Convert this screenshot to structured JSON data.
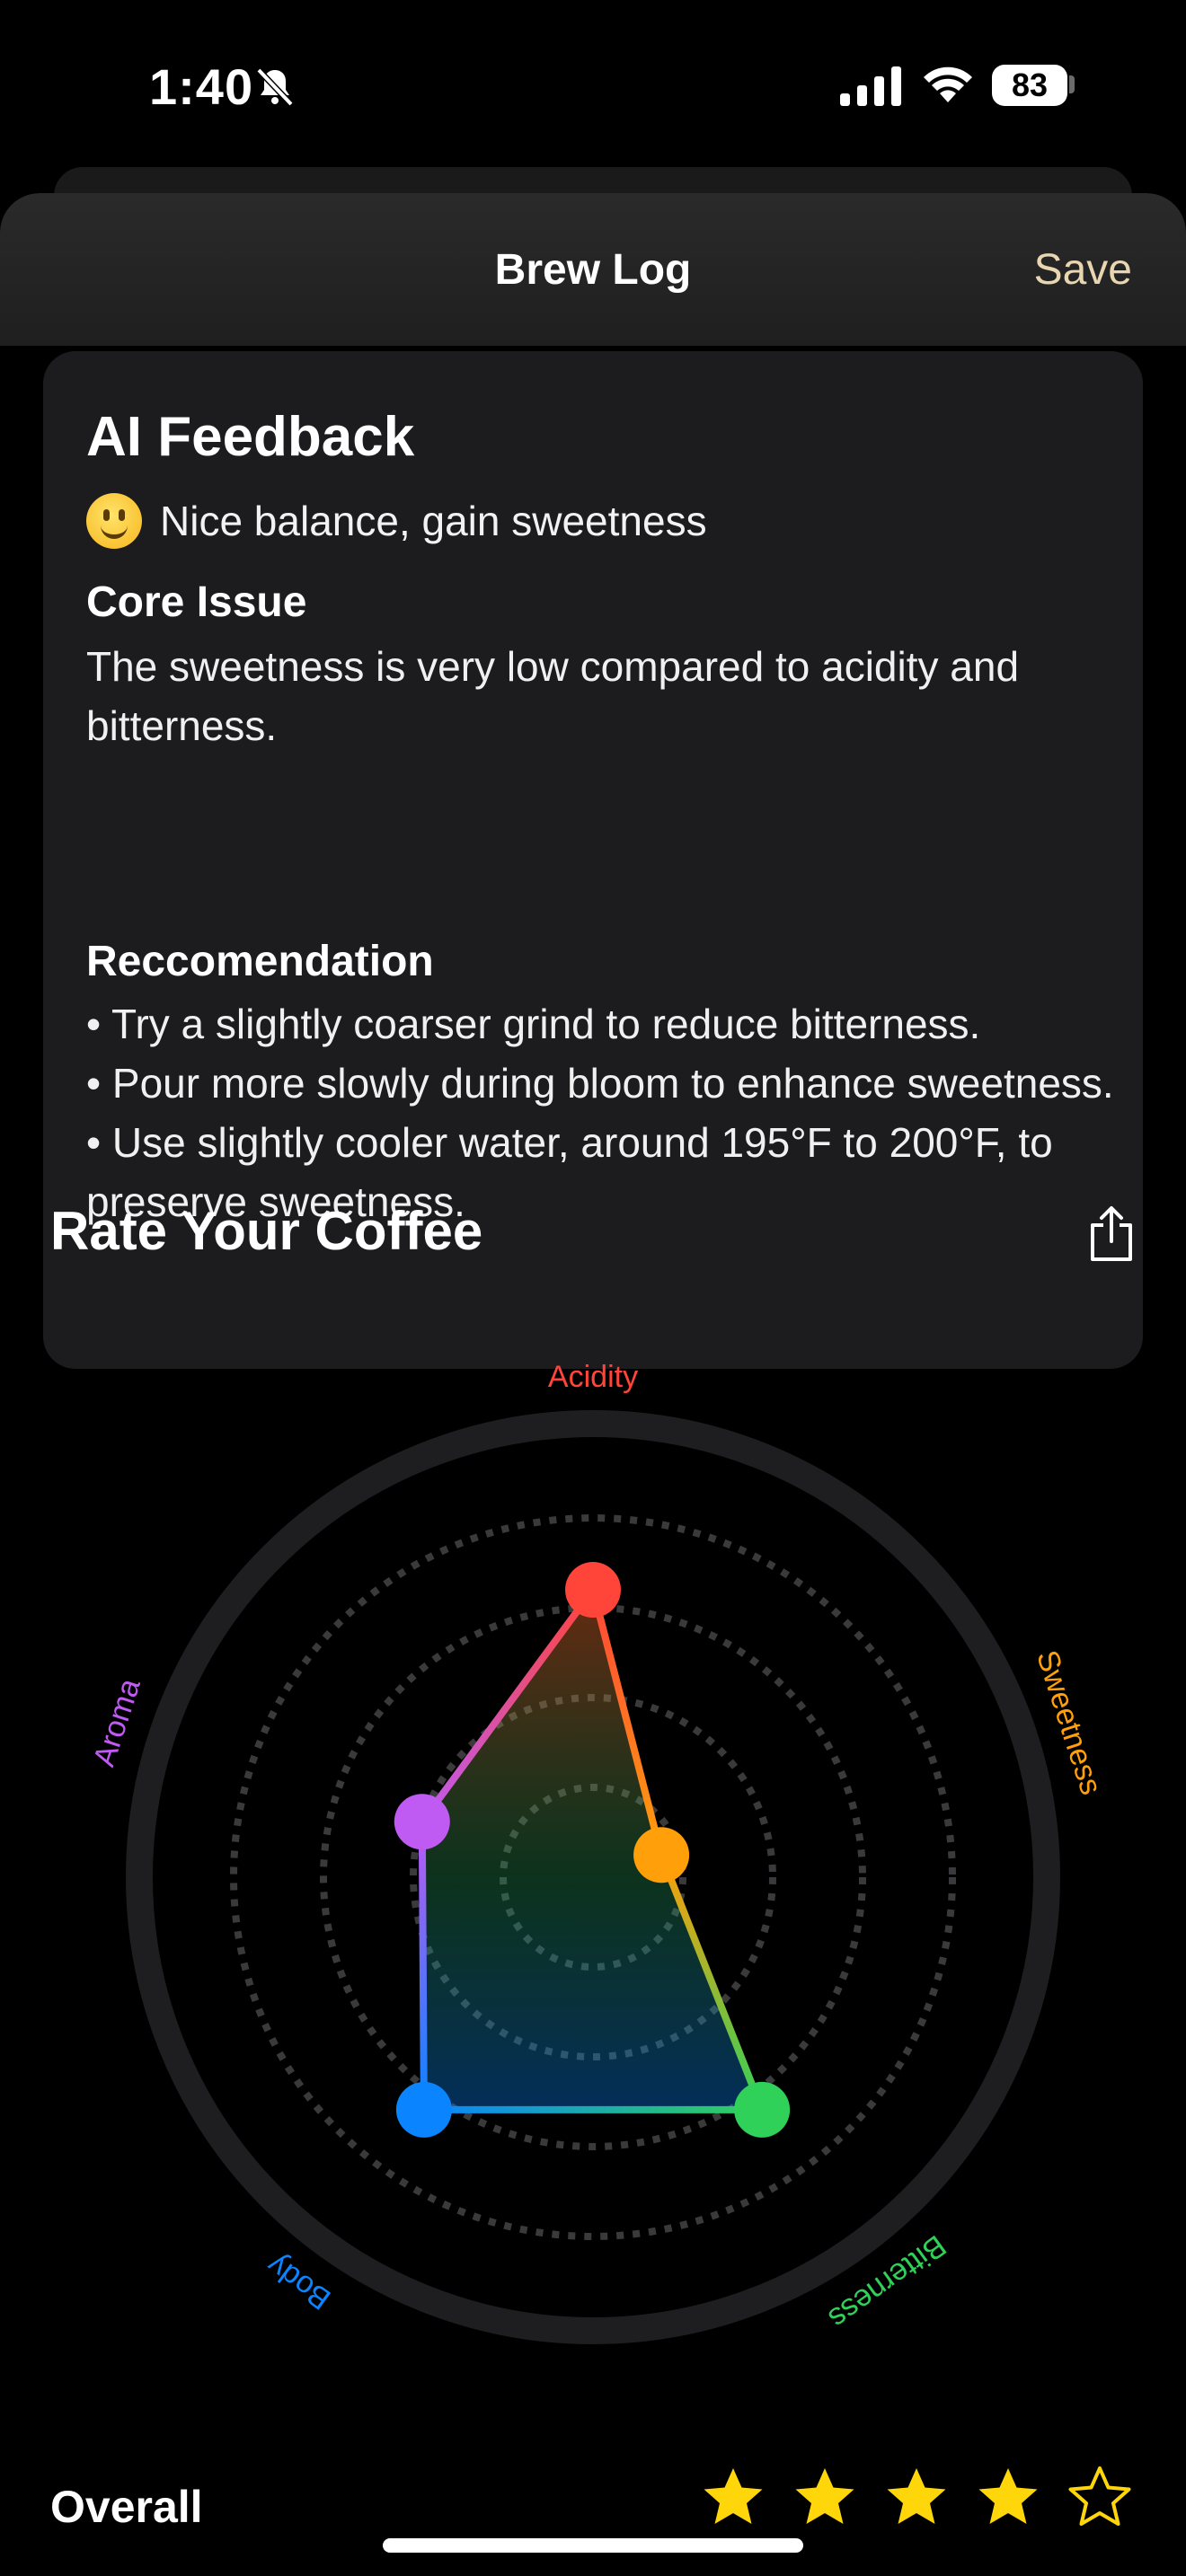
{
  "status": {
    "time": "1:40",
    "battery": "83"
  },
  "nav": {
    "title": "Brew Log",
    "save": "Save"
  },
  "feedback": {
    "title": "AI Feedback",
    "summary": "Nice balance, gain sweetness",
    "core_heading": "Core Issue",
    "core_text": "The sweetness is very low compared to acidity and bitterness.",
    "rec_heading": "Reccomendation",
    "recommendations": [
      "• Try a slightly coarser grind to reduce bitterness.",
      "• Pour more slowly during bloom to enhance sweetness.",
      "• Use slightly cooler water, around 195°F to 200°F, to preserve sweetness."
    ]
  },
  "rating": {
    "title": "Rate Your Coffee",
    "overall_label": "Overall",
    "stars": 4,
    "max_stars": 5
  },
  "chart_data": {
    "type": "radar",
    "axes": [
      "Acidity",
      "Sweetness",
      "Bitterness",
      "Body",
      "Aroma"
    ],
    "values": [
      4,
      1,
      4,
      4,
      2.5
    ],
    "max": 5,
    "colors": {
      "Acidity": "#ff453a",
      "Sweetness": "#ff9f0a",
      "Bitterness": "#30d158",
      "Body": "#0a84ff",
      "Aroma": "#bf5af2"
    }
  }
}
